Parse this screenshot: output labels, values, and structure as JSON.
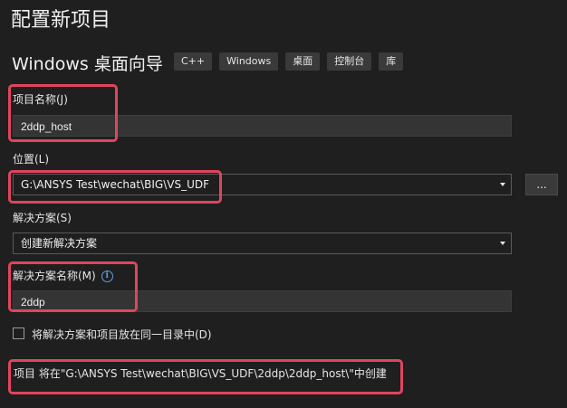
{
  "page_title": "配置新项目",
  "template_title": "Windows 桌面向导",
  "tags": [
    "C++",
    "Windows",
    "桌面",
    "控制台",
    "库"
  ],
  "project_name": {
    "label": "项目名称(J)",
    "value": "2ddp_host"
  },
  "location": {
    "label": "位置(L)",
    "value": "G:\\ANSYS Test\\wechat\\BIG\\VS_UDF",
    "browse_label": "..."
  },
  "solution": {
    "label": "解决方案(S)",
    "value": "创建新解决方案"
  },
  "solution_name": {
    "label": "解决方案名称(M)",
    "value": "2ddp",
    "info_icon": "i"
  },
  "same_dir": {
    "label": "将解决方案和项目放在同一目录中(D)",
    "checked": false
  },
  "footer_note": "项目 将在\"G:\\ANSYS Test\\wechat\\BIG\\VS_UDF\\2ddp\\2ddp_host\\\"中创建",
  "colors": {
    "highlight": "#e0455e",
    "background": "#1f1f1f",
    "info": "#5aa0e6"
  }
}
